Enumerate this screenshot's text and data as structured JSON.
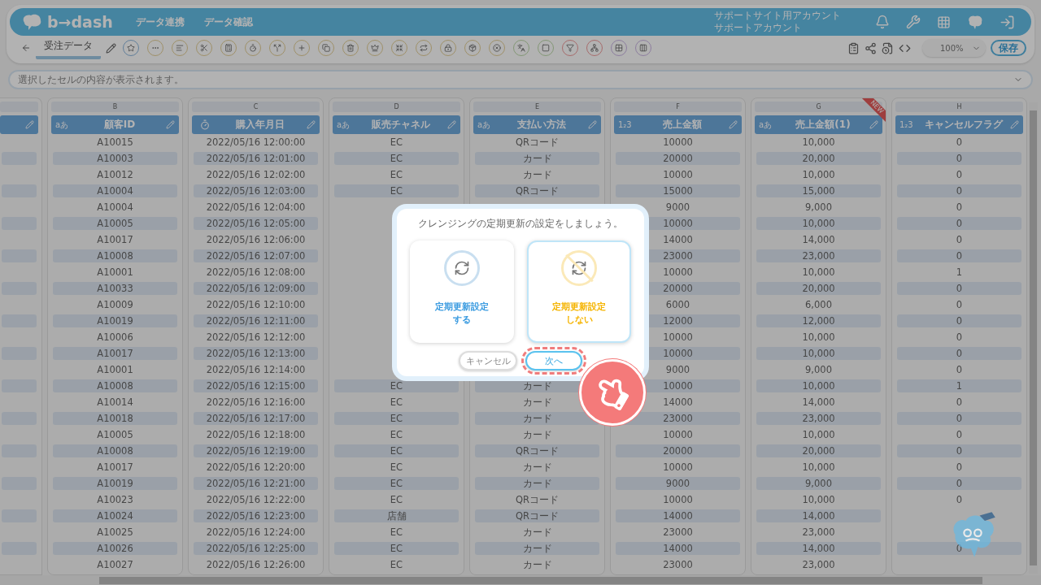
{
  "header": {
    "logo": "b→dash",
    "nav": [
      {
        "label": "データ連携"
      },
      {
        "label": "データ確認"
      }
    ],
    "account": [
      "サポートサイト用アカウント",
      "サポートアカウント"
    ]
  },
  "toolbar": {
    "tabs": [
      {
        "label": "受注データ",
        "selected": true
      }
    ],
    "zoom": "100%",
    "save": "保存"
  },
  "formula_bar": {
    "placeholder": "選択したセルの内容が表示されます。"
  },
  "table": {
    "columns": [
      {
        "kind": "partial"
      },
      {
        "letter": "B",
        "name": "顧客ID",
        "kind": "text",
        "type_label": "aあ",
        "cells": [
          "A10015",
          "A10003",
          "A10012",
          "A10004",
          "A10004",
          "A10005",
          "A10017",
          "A10008",
          "A10001",
          "A10033",
          "A10009",
          "A10019",
          "A10006",
          "A10017",
          "A10001",
          "A10008",
          "A10014",
          "A10018",
          "A10005",
          "A10008",
          "A10017",
          "A10019",
          "A10023",
          "A10024",
          "A10025",
          "A10026",
          "A10027"
        ]
      },
      {
        "letter": "C",
        "name": "購入年月日",
        "kind": "datetime",
        "cells": [
          "2022/05/16 12:00:00",
          "2022/05/16 12:01:00",
          "2022/05/16 12:02:00",
          "2022/05/16 12:03:00",
          "2022/05/16 12:04:00",
          "2022/05/16 12:05:00",
          "2022/05/16 12:06:00",
          "2022/05/16 12:07:00",
          "2022/05/16 12:08:00",
          "2022/05/16 12:09:00",
          "2022/05/16 12:10:00",
          "2022/05/16 12:11:00",
          "2022/05/16 12:12:00",
          "2022/05/16 12:13:00",
          "2022/05/16 12:14:00",
          "2022/05/16 12:15:00",
          "2022/05/16 12:16:00",
          "2022/05/16 12:17:00",
          "2022/05/16 12:18:00",
          "2022/05/16 12:19:00",
          "2022/05/16 12:20:00",
          "2022/05/16 12:21:00",
          "2022/05/16 12:22:00",
          "2022/05/16 12:23:00",
          "2022/05/16 12:24:00",
          "2022/05/16 12:25:00",
          "2022/05/16 12:26:00"
        ]
      },
      {
        "letter": "D",
        "name": "販売チャネル",
        "kind": "text",
        "type_label": "aあ",
        "cells": [
          "EC",
          "EC",
          "EC",
          "EC",
          null,
          null,
          null,
          null,
          null,
          null,
          null,
          null,
          null,
          null,
          null,
          "EC",
          "EC",
          "EC",
          "EC",
          "EC",
          "EC",
          "EC",
          "EC",
          "店舗",
          "EC",
          "EC",
          "EC"
        ]
      },
      {
        "letter": "E",
        "name": "支払い方法",
        "kind": "text",
        "type_label": "aあ",
        "cells": [
          "QRコード",
          "カード",
          "カード",
          "QRコード",
          null,
          null,
          null,
          null,
          null,
          null,
          null,
          null,
          null,
          null,
          null,
          "カード",
          "カード",
          "カード",
          "カード",
          "QRコード",
          "カード",
          "カード",
          "QRコード",
          "QRコード",
          "カード",
          "カード",
          "カード"
        ]
      },
      {
        "letter": "F",
        "name": "売上金額",
        "kind": "number",
        "type_label": "1₂3",
        "cells": [
          "10000",
          "20000",
          "10000",
          "15000",
          "9000",
          "10000",
          "14000",
          "23000",
          "10000",
          "20000",
          "6000",
          "12000",
          "10000",
          "10000",
          "9000",
          "10000",
          "14000",
          "23000",
          "10000",
          "20000",
          "10000",
          "9000",
          "10000",
          "14000",
          "23000",
          "14000",
          "23000"
        ]
      },
      {
        "letter": "G",
        "name": "売上金額(1)",
        "kind": "text",
        "type_label": "aあ",
        "badge": "NEW",
        "cells": [
          "10,000",
          "20,000",
          "10,000",
          "15,000",
          "9,000",
          "10,000",
          "14,000",
          "23,000",
          "10,000",
          "20,000",
          "6,000",
          "12,000",
          "10,000",
          "10,000",
          "9,000",
          "10,000",
          "14,000",
          "23,000",
          "10,000",
          "20,000",
          "10,000",
          "9,000",
          "10,000",
          "14,000",
          "23,000",
          "14,000",
          "23,000"
        ]
      },
      {
        "letter": "H",
        "name": "キャンセルフラグ",
        "kind": "number",
        "type_label": "1₂3",
        "cells": [
          "0",
          "0",
          "0",
          "0",
          "0",
          "0",
          "0",
          "0",
          "1",
          "0",
          "0",
          "0",
          "0",
          "0",
          "0",
          "1",
          "0",
          "0",
          "0",
          "0",
          "0",
          "0",
          "0",
          null,
          null,
          "0",
          null
        ]
      }
    ]
  },
  "dialog": {
    "title": "クレンジングの定期更新の設定をしましょう。",
    "options": [
      {
        "kind": "enable",
        "lines": [
          "定期更新設定",
          "する"
        ],
        "selected": false
      },
      {
        "kind": "disable",
        "lines": [
          "定期更新設定",
          "しない"
        ],
        "selected": true
      }
    ],
    "buttons": [
      {
        "label": "キャンセル",
        "kind": "secondary",
        "highlighted": false
      },
      {
        "label": "次へ",
        "kind": "primary",
        "highlighted": true
      }
    ]
  }
}
